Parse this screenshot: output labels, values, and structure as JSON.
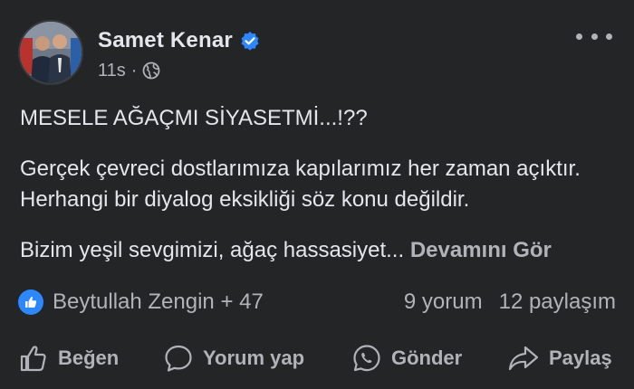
{
  "post": {
    "author": "Samet Kenar",
    "verified": true,
    "time": "11s",
    "separator": "·",
    "audience_icon": "globe-icon",
    "paragraphs": [
      "MESELE AĞAÇMI SİYASETMİ...!??",
      "Gerçek çevreci dostlarımıza kapılarımız her zaman açıktır. Herhangi bir diyalog eksikliği söz konu değildir.",
      "Bizim yeşil sevgimizi, ağaç hassasiyet..."
    ],
    "see_more": "Devamını Gör"
  },
  "reactions": {
    "icon": "like-icon",
    "names": "Beytullah Zengin + 47",
    "comments": "9 yorum",
    "shares": "12 paylaşım"
  },
  "actions": {
    "like": "Beğen",
    "comment": "Yorum yap",
    "send": "Gönder",
    "share": "Paylaş"
  },
  "colors": {
    "background": "#242526",
    "text": "#e4e6eb",
    "secondary": "#b0b3b8",
    "accent": "#2d88ff"
  }
}
